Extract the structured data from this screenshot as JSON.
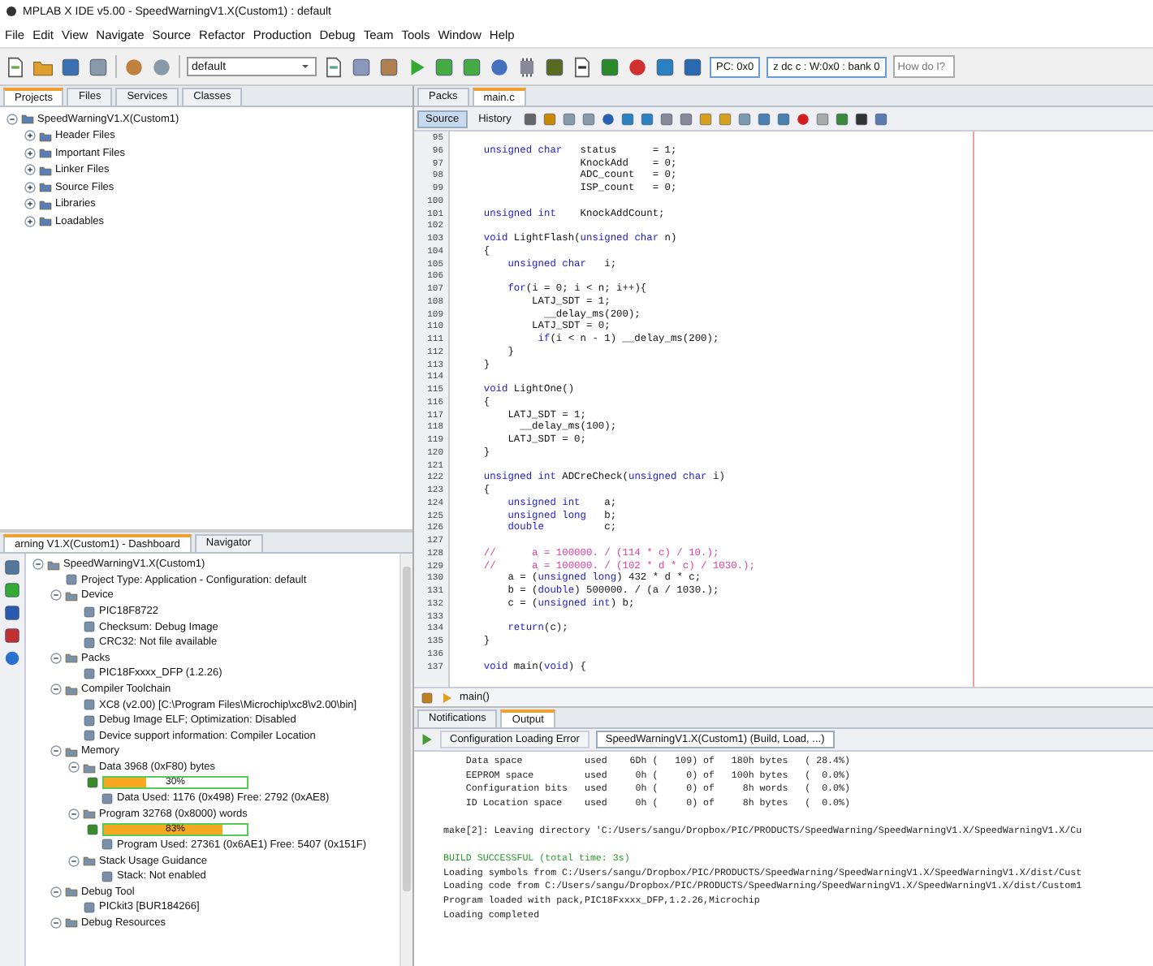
{
  "window": {
    "title": "MPLAB X IDE v5.00 - SpeedWarningV1.X(Custom1) : default"
  },
  "menu": [
    "File",
    "Edit",
    "View",
    "Navigate",
    "Source",
    "Refactor",
    "Production",
    "Debug",
    "Team",
    "Tools",
    "Window",
    "Help"
  ],
  "toolbar": {
    "configuration": "default",
    "pc_reading": "PC: 0x0",
    "status_reading": "z dc c : W:0x0 : bank 0",
    "help_search": {
      "placeholder": "How do I?"
    }
  },
  "projects_panel": {
    "tabs": [
      {
        "label": "Projects",
        "selected": true
      },
      {
        "label": "Files",
        "selected": false
      },
      {
        "label": "Services",
        "selected": false
      },
      {
        "label": "Classes",
        "selected": false
      }
    ],
    "tree": [
      {
        "label": "SpeedWarningV1.X(Custom1)",
        "expanded": true,
        "children": [
          {
            "label": "Header Files",
            "expanded": false
          },
          {
            "label": "Important Files",
            "expanded": false
          },
          {
            "label": "Linker Files",
            "expanded": false
          },
          {
            "label": "Source Files",
            "expanded": false
          },
          {
            "label": "Libraries",
            "expanded": false
          },
          {
            "label": "Loadables",
            "expanded": false
          }
        ]
      }
    ]
  },
  "dashboard_panel": {
    "tabs": [
      {
        "label": "arning V1.X(Custom1) - Dashboard",
        "selected": true
      },
      {
        "label": "Navigator",
        "selected": false
      }
    ],
    "tree": [
      {
        "label": "SpeedWarningV1.X(Custom1)",
        "expanded": true,
        "children": [
          {
            "label": "Project Type: Application - Configuration: default"
          },
          {
            "label": "Device",
            "expanded": true,
            "children": [
              {
                "label": "PIC18F8722"
              },
              {
                "label": "Checksum: Debug Image"
              },
              {
                "label": "CRC32: Not file available"
              }
            ]
          },
          {
            "label": "Packs",
            "expanded": true,
            "children": [
              {
                "label": "PIC18Fxxxx_DFP (1.2.26)"
              }
            ]
          },
          {
            "label": "Compiler Toolchain",
            "expanded": true,
            "children": [
              {
                "label": "XC8 (v2.00) [C:\\Program Files\\Microchip\\xc8\\v2.00\\bin]"
              },
              {
                "label": "Debug Image ELF; Optimization: Disabled"
              },
              {
                "label": "Device support information: Compiler Location"
              }
            ]
          },
          {
            "label": "Memory",
            "expanded": true,
            "children": [
              {
                "label": "Data 3968 (0xF80) bytes",
                "expanded": true,
                "children": [
                  {
                    "kind": "progress",
                    "level": 0.3,
                    "reading": "30%"
                  },
                  {
                    "label": "Data Used: 1176 (0x498) Free: 2792 (0xAE8)"
                  }
                ]
              },
              {
                "label": "Program 32768 (0x8000) words",
                "expanded": true,
                "children": [
                  {
                    "kind": "progress",
                    "level": 0.83,
                    "reading": "83%"
                  },
                  {
                    "label": "Program Used: 27361 (0x6AE1) Free: 5407 (0x151F)"
                  }
                ]
              },
              {
                "label": "Stack Usage Guidance",
                "expanded": true,
                "children": [
                  {
                    "label": "Stack: Not enabled"
                  }
                ]
              }
            ]
          },
          {
            "label": "Debug Tool",
            "expanded": true,
            "children": [
              {
                "label": "PICkit3 [BUR184266]"
              }
            ]
          },
          {
            "label": "Debug Resources",
            "expanded": true
          }
        ]
      }
    ]
  },
  "editor": {
    "tabs": [
      {
        "label": "Packs",
        "selected": false
      },
      {
        "label": "main.c",
        "selected": true
      }
    ],
    "views": [
      {
        "label": "Source",
        "selected": true
      },
      {
        "label": "History",
        "selected": false
      }
    ],
    "lines": [
      {
        "number": "95"
      },
      {
        "number": "96",
        "tokens": [
          {
            "kind": "kw",
            "text": "    unsigned char"
          },
          {
            "kind": "id",
            "text": "   status      = 1;"
          }
        ]
      },
      {
        "number": "97",
        "tokens": [
          {
            "kind": "id",
            "text": "                    KnockAdd    = 0;"
          }
        ]
      },
      {
        "number": "98",
        "tokens": [
          {
            "kind": "id",
            "text": "                    ADC_count   = 0;"
          }
        ]
      },
      {
        "number": "99",
        "tokens": [
          {
            "kind": "id",
            "text": "                    ISP_count   = 0;"
          }
        ]
      },
      {
        "number": "100"
      },
      {
        "number": "101",
        "tokens": [
          {
            "kind": "kw",
            "text": "    unsigned int"
          },
          {
            "kind": "id",
            "text": "    KnockAddCount;"
          }
        ]
      },
      {
        "number": "102"
      },
      {
        "number": "103",
        "tokens": [
          {
            "kind": "kw",
            "text": "    void"
          },
          {
            "kind": "id",
            "text": " LightFlash("
          },
          {
            "kind": "kw",
            "text": "unsigned char"
          },
          {
            "kind": "id",
            "text": " n)"
          }
        ]
      },
      {
        "number": "104",
        "tokens": [
          {
            "kind": "id",
            "text": "    {"
          }
        ]
      },
      {
        "number": "105",
        "tokens": [
          {
            "kind": "kw",
            "text": "        unsigned char"
          },
          {
            "kind": "id",
            "text": "   i;"
          }
        ]
      },
      {
        "number": "106"
      },
      {
        "number": "107",
        "tokens": [
          {
            "kind": "kw",
            "text": "        for"
          },
          {
            "kind": "id",
            "text": "(i = 0; i < n; i++){"
          }
        ]
      },
      {
        "number": "108",
        "tokens": [
          {
            "kind": "id",
            "text": "            LATJ_SDT = 1;"
          }
        ]
      },
      {
        "number": "109",
        "tokens": [
          {
            "kind": "id",
            "text": "              __delay_ms(200);"
          }
        ]
      },
      {
        "number": "110",
        "tokens": [
          {
            "kind": "id",
            "text": "            LATJ_SDT = 0;"
          }
        ]
      },
      {
        "number": "111",
        "tokens": [
          {
            "kind": "kw",
            "text": "             if"
          },
          {
            "kind": "id",
            "text": "(i < n - 1) __delay_ms(200);"
          }
        ]
      },
      {
        "number": "112",
        "tokens": [
          {
            "kind": "id",
            "text": "        }"
          }
        ]
      },
      {
        "number": "113",
        "tokens": [
          {
            "kind": "id",
            "text": "    }"
          }
        ]
      },
      {
        "number": "114"
      },
      {
        "number": "115",
        "tokens": [
          {
            "kind": "kw",
            "text": "    void"
          },
          {
            "kind": "id",
            "text": " LightOne()"
          }
        ]
      },
      {
        "number": "116",
        "tokens": [
          {
            "kind": "id",
            "text": "    {"
          }
        ]
      },
      {
        "number": "117",
        "tokens": [
          {
            "kind": "id",
            "text": "        LATJ_SDT = 1;"
          }
        ]
      },
      {
        "number": "118",
        "tokens": [
          {
            "kind": "id",
            "text": "          __delay_ms(100);"
          }
        ]
      },
      {
        "number": "119",
        "tokens": [
          {
            "kind": "id",
            "text": "        LATJ_SDT = 0;"
          }
        ]
      },
      {
        "number": "120",
        "tokens": [
          {
            "kind": "id",
            "text": "    }"
          }
        ]
      },
      {
        "number": "121"
      },
      {
        "number": "122",
        "tokens": [
          {
            "kind": "kw",
            "text": "    unsigned int"
          },
          {
            "kind": "id",
            "text": " ADCreCheck("
          },
          {
            "kind": "kw",
            "text": "unsigned char"
          },
          {
            "kind": "id",
            "text": " i)"
          }
        ]
      },
      {
        "number": "123",
        "tokens": [
          {
            "kind": "id",
            "text": "    {"
          }
        ]
      },
      {
        "number": "124",
        "tokens": [
          {
            "kind": "kw",
            "text": "        unsigned int"
          },
          {
            "kind": "id",
            "text": "    a;"
          }
        ]
      },
      {
        "number": "125",
        "tokens": [
          {
            "kind": "kw",
            "text": "        unsigned long"
          },
          {
            "kind": "id",
            "text": "   b;"
          }
        ]
      },
      {
        "number": "126",
        "tokens": [
          {
            "kind": "kw",
            "text": "        double"
          },
          {
            "kind": "id",
            "text": "          c;"
          }
        ]
      },
      {
        "number": "127"
      },
      {
        "number": "128",
        "tokens": [
          {
            "kind": "cm",
            "text": "    //      a = 100000. / (114 * c) / 10.);"
          }
        ]
      },
      {
        "number": "129",
        "tokens": [
          {
            "kind": "cm",
            "text": "    //      a = 100000. / (102 * d * c) / 1030.);"
          }
        ]
      },
      {
        "number": "130",
        "tokens": [
          {
            "kind": "id",
            "text": "        a = ("
          },
          {
            "kind": "kw",
            "text": "unsigned long"
          },
          {
            "kind": "id",
            "text": ") 432 * d * c;"
          }
        ]
      },
      {
        "number": "131",
        "tokens": [
          {
            "kind": "id",
            "text": "        b = ("
          },
          {
            "kind": "kw",
            "text": "double"
          },
          {
            "kind": "id",
            "text": ") 500000. / (a / 1030.);"
          }
        ]
      },
      {
        "number": "132",
        "tokens": [
          {
            "kind": "id",
            "text": "        c = ("
          },
          {
            "kind": "kw",
            "text": "unsigned int"
          },
          {
            "kind": "id",
            "text": ") b;"
          }
        ]
      },
      {
        "number": "133"
      },
      {
        "number": "134",
        "tokens": [
          {
            "kind": "kw",
            "text": "        return"
          },
          {
            "kind": "id",
            "text": "(c);"
          }
        ]
      },
      {
        "number": "135",
        "tokens": [
          {
            "kind": "id",
            "text": "    }"
          }
        ]
      },
      {
        "number": "136"
      },
      {
        "number": "137",
        "tokens": [
          {
            "kind": "kw",
            "text": "    void"
          },
          {
            "kind": "id",
            "text": " main("
          },
          {
            "kind": "kw",
            "text": "void"
          },
          {
            "kind": "id",
            "text": ") {"
          }
        ]
      }
    ],
    "breadcrumb": "main()"
  },
  "output_panel": {
    "tabs": [
      {
        "label": "Notifications",
        "selected": false
      },
      {
        "label": "Output",
        "selected": true
      }
    ],
    "subtabs": [
      {
        "label": "Configuration Loading Error",
        "selected": false
      },
      {
        "label": "SpeedWarningV1.X(Custom1) (Build, Load, ...)",
        "selected": true
      }
    ],
    "lines": [
      {
        "kind": "normal",
        "text": "    Data space           used    6Dh (   109) of   180h bytes   ( 28.4%)"
      },
      {
        "kind": "normal",
        "text": "    EEPROM space         used     0h (     0) of   100h bytes   (  0.0%)"
      },
      {
        "kind": "normal",
        "text": "    Configuration bits   used     0h (     0) of     8h words   (  0.0%)"
      },
      {
        "kind": "normal",
        "text": "    ID Location space    used     0h (     0) of     8h bytes   (  0.0%)"
      },
      {
        "kind": "blank"
      },
      {
        "kind": "normal",
        "text": "make[2]: Leaving directory 'C:/Users/sangu/Dropbox/PIC/PRODUCTS/SpeedWarning/SpeedWarningV1.X/SpeedWarningV1.X/Cu"
      },
      {
        "kind": "blank"
      },
      {
        "kind": "success",
        "text": "BUILD SUCCESSFUL (total time: 3s)"
      },
      {
        "kind": "normal",
        "text": "Loading symbols from C:/Users/sangu/Dropbox/PIC/PRODUCTS/SpeedWarning/SpeedWarningV1.X/SpeedWarningV1.X/dist/Cust"
      },
      {
        "kind": "normal",
        "text": "Loading code from C:/Users/sangu/Dropbox/PIC/PRODUCTS/SpeedWarning/SpeedWarningV1.X/SpeedWarningV1.X/dist/Custom1"
      },
      {
        "kind": "normal",
        "text": "Program loaded with pack,PIC18Fxxxx_DFP,1.2.26,Microchip"
      },
      {
        "kind": "normal",
        "text": "Loading completed"
      }
    ]
  }
}
